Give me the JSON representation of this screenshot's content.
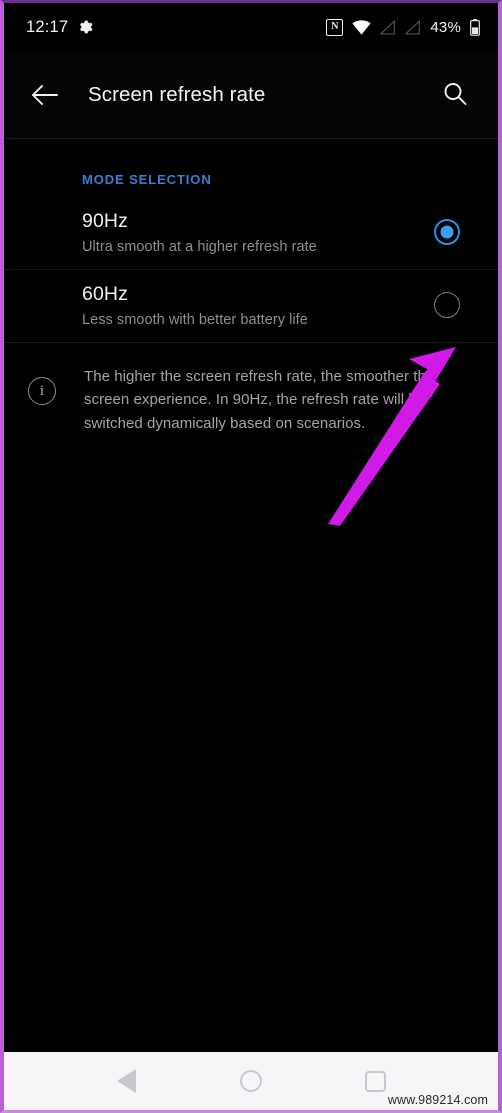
{
  "status_bar": {
    "time": "12:17",
    "settings_icon": "gear-icon",
    "nfc_icon": "nfc-icon",
    "nfc_glyph": "N",
    "wifi_icon": "wifi-icon",
    "signal_icon_1": "no-sim-signal-icon",
    "signal_icon_2": "no-sim-signal-icon",
    "battery_percent": "43%",
    "battery_icon": "battery-icon"
  },
  "app_bar": {
    "back_icon": "back-arrow-icon",
    "title": "Screen refresh rate",
    "search_icon": "search-icon"
  },
  "content": {
    "section_label": "MODE SELECTION",
    "options": [
      {
        "title": "90Hz",
        "subtitle": "Ultra smooth at a higher refresh rate",
        "selected": true
      },
      {
        "title": "60Hz",
        "subtitle": "Less smooth with better battery life",
        "selected": false
      }
    ],
    "info": {
      "icon": "info-icon",
      "glyph": "i",
      "text": "The higher the screen refresh rate, the smoother the screen experience. In 90Hz, the refresh rate will be switched dynamically based on scenarios."
    }
  },
  "annotation": {
    "arrow_color": "#d11ae8",
    "points_to": "60Hz radio button"
  },
  "nav_bar": {
    "back_icon": "nav-back-triangle-icon",
    "home_icon": "nav-home-circle-icon",
    "recents_icon": "nav-recents-square-icon"
  },
  "watermark": {
    "text": "www.989214.com"
  },
  "colors": {
    "accent_blue": "#3b7fd4",
    "radio_blue": "#3d9ef0",
    "arrow_magenta": "#d11ae8",
    "background": "#000000",
    "navbar_background": "#f7f5f8",
    "frame_purple": "#b760d8"
  }
}
